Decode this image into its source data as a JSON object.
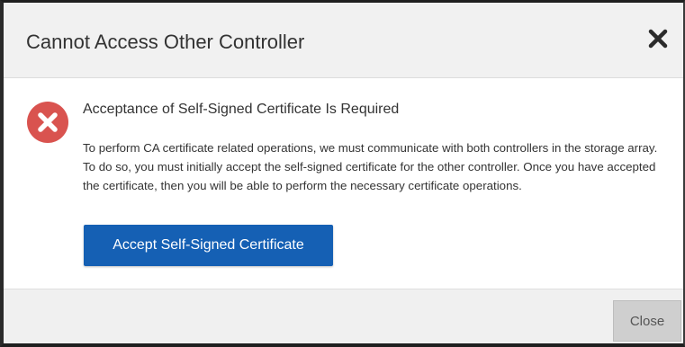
{
  "dialog": {
    "title": "Cannot Access Other Controller",
    "close_icon": "close-icon"
  },
  "body": {
    "icon": "error-icon",
    "icon_color": "#d9534f",
    "heading": "Acceptance of Self-Signed Certificate Is Required",
    "message": "To perform CA certificate related operations, we must communicate with both controllers in the storage array. To do so, you must initially accept the self-signed certificate for the other controller. Once you have accepted the certificate, then you will be able to perform the necessary certificate operations.",
    "accept_button_label": "Accept Self-Signed Certificate",
    "accent_color": "#1560b4"
  },
  "footer": {
    "close_button_label": "Close"
  }
}
